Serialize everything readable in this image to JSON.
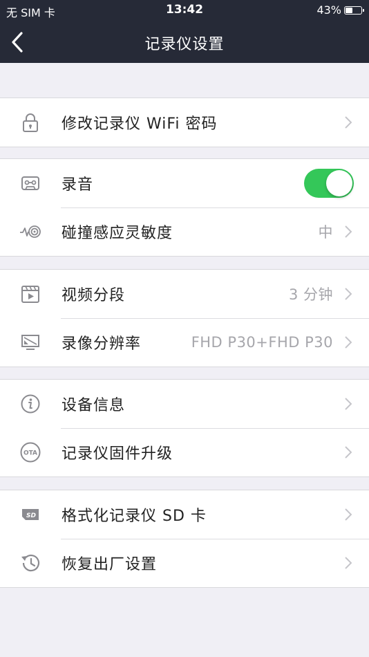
{
  "status_bar": {
    "carrier": "无 SIM 卡",
    "time": "13:42",
    "battery_text": "43%",
    "battery_level": 0.43
  },
  "nav": {
    "back_icon": "chevron-left-icon",
    "title": "记录仪设置"
  },
  "colors": {
    "nav_bg": "#262a37",
    "toggle_on": "#34c759",
    "page_bg": "#f0eff5",
    "secondary_text": "#a6a6ab"
  },
  "groups": [
    {
      "items": [
        {
          "label": "修改记录仪 WiFi 密码",
          "icon": "lock-icon"
        }
      ]
    },
    {
      "items": [
        {
          "label": "录音",
          "icon": "cassette-icon",
          "toggle": true
        },
        {
          "label": "碰撞感应灵敏度",
          "icon": "sensor-icon",
          "value": "中"
        }
      ]
    },
    {
      "items": [
        {
          "label": "视频分段",
          "icon": "film-clapper-icon",
          "value": "3 分钟"
        },
        {
          "label": "录像分辨率",
          "icon": "resolution-monitor-icon",
          "value": "FHD P30+FHD P30"
        }
      ]
    },
    {
      "items": [
        {
          "label": "设备信息",
          "icon": "info-icon"
        },
        {
          "label": "记录仪固件升级",
          "icon": "ota-icon"
        }
      ]
    },
    {
      "items": [
        {
          "label": "格式化记录仪 SD 卡",
          "icon": "sd-card-icon"
        },
        {
          "label": "恢复出厂设置",
          "icon": "restore-clock-icon"
        }
      ]
    }
  ]
}
